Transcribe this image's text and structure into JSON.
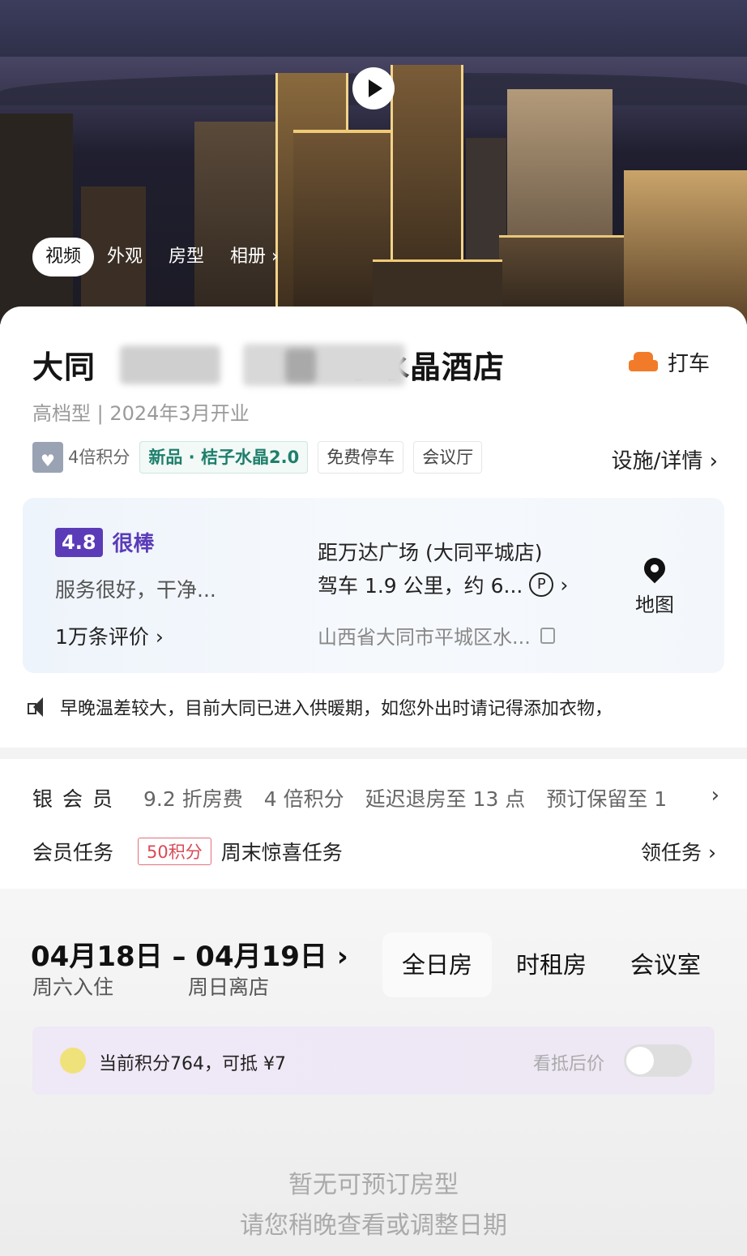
{
  "media_tabs": [
    "视频",
    "外观",
    "房型",
    "相册"
  ],
  "hotel": {
    "title_start": "大同",
    "title_end": "子水晶酒店",
    "subtitle": "高档型 | 2024年3月开业",
    "taxi_label": "打车"
  },
  "tags": {
    "points": "4倍积分",
    "new": "新品 · 桔子水晶2.0",
    "parking": "免费停车",
    "meeting": "会议厅",
    "facilities": "设施/详情 ›"
  },
  "review": {
    "score": "4.8",
    "word": "很棒",
    "snippet": "服务很好，干净...",
    "count": "1万条评价 ›"
  },
  "location": {
    "distance_line1": "距万达广场 (大同平城店)",
    "distance_line2": "驾车 1.9 公里，约 6...",
    "parking_glyph": "P",
    "address": "山西省大同市平城区水...",
    "map_label": "地图"
  },
  "notice": "早晚温差较大，目前大同已进入供暖期，如您外出时请记得添加衣物，",
  "member": {
    "level": "银会员",
    "benefits": [
      "9.2 折房费",
      "4 倍积分",
      "延迟退房至 13 点",
      "预订保留至 1"
    ],
    "task_label": "会员任务",
    "task_points": "50积分",
    "task_name": "周末惊喜任务",
    "task_link": "领任务 ›"
  },
  "dates": {
    "range": "04月18日 – 04月19日 ›",
    "checkin": "周六入住",
    "checkout": "周日离店"
  },
  "room_tabs": [
    "全日房",
    "时租房",
    "会议室"
  ],
  "points_bar": {
    "text": "当前积分764，可抵 ¥7",
    "deduct_label": "看抵后价"
  },
  "empty": {
    "line1": "暂无可预订房型",
    "line2": "请您稍晚查看或调整日期"
  }
}
